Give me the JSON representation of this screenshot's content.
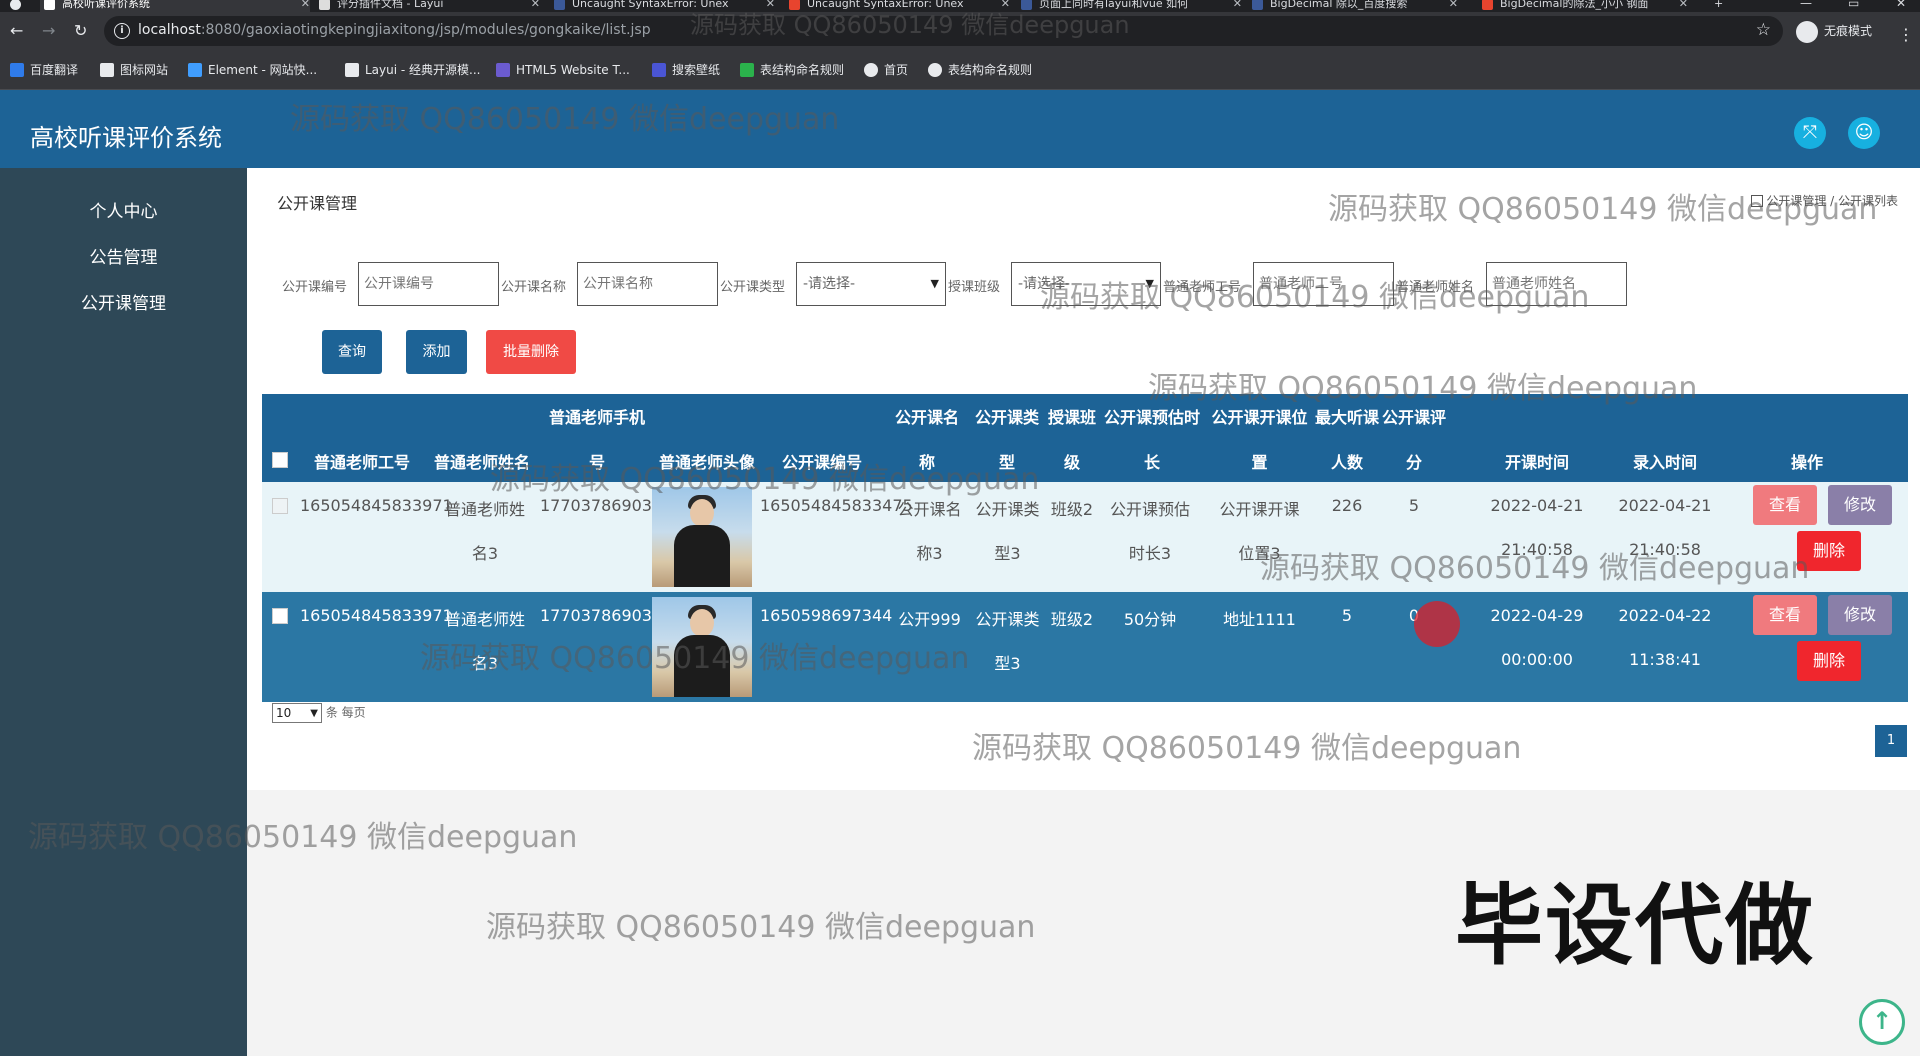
{
  "browser": {
    "tabs": [
      {
        "title": "高校听课评价系统",
        "active": true,
        "color": "#ffffff"
      },
      {
        "title": "评分插件文档 - Layui",
        "active": false,
        "color": "#dddddd"
      },
      {
        "title": "Uncaught SyntaxError: Unex",
        "active": false,
        "color": "#3b5998"
      },
      {
        "title": "Uncaught SyntaxError: Unex",
        "active": false,
        "color": "#e8442e"
      },
      {
        "title": "页面上同时有layui和vue 如何",
        "active": false,
        "color": "#3b5998"
      },
      {
        "title": "BigDecimal 除以_百度搜索",
        "active": false,
        "color": "#3b5998"
      },
      {
        "title": "BigDecimal的除法_小小 钢面",
        "active": false,
        "color": "#e8442e"
      }
    ],
    "new_tab": "+",
    "url_host": "localhost",
    "url_rest": ":8080/gaoxiaotingkepingjiaxitong/jsp/modules/gongkaike/list.jsp",
    "incognito_label": "无痕模式",
    "bookmarks": [
      {
        "label": "百度翻译",
        "icon": "translate-icon",
        "color": "#2f7bea"
      },
      {
        "label": "图标网站",
        "icon": "flag-icon",
        "color": "#e8eaed"
      },
      {
        "label": "Element - 网站快...",
        "icon": "element-icon",
        "color": "#409eff"
      },
      {
        "label": "Layui - 经典开源模...",
        "icon": "layui-icon",
        "color": "#e8eaed"
      },
      {
        "label": "HTML5 Website T...",
        "icon": "html5-icon",
        "color": "#6b5bcf"
      },
      {
        "label": "搜索壁纸",
        "icon": "wallpaper-icon",
        "color": "#4a55d4"
      },
      {
        "label": "表结构命名规则",
        "icon": "table-icon",
        "color": "#2bb24c"
      },
      {
        "label": "首页",
        "icon": "globe-icon",
        "color": "#e8eaed"
      },
      {
        "label": "表结构命名规则",
        "icon": "globe-icon",
        "color": "#e8eaed"
      }
    ]
  },
  "app": {
    "title": "高校听课评价系统",
    "accent": "#1d6396",
    "sidebar_bg": "#2e4857"
  },
  "sidebar": {
    "items": [
      {
        "label": "个人中心"
      },
      {
        "label": "公告管理"
      },
      {
        "label": "公开课管理"
      }
    ]
  },
  "page": {
    "title": "公开课管理",
    "breadcrumb": "公开课管理 / 公开课列表"
  },
  "search": {
    "fields": [
      {
        "label": "公开课编号",
        "placeholder": "公开课编号"
      },
      {
        "label": "公开课名称",
        "placeholder": "公开课名称"
      },
      {
        "label": "公开课类型",
        "select": "-请选择-"
      },
      {
        "label": "授课班级",
        "select": "-请选择-"
      },
      {
        "label": "普通老师工号",
        "placeholder": "普通老师工号"
      },
      {
        "label": "普通老师姓名",
        "placeholder": "普通老师姓名"
      }
    ],
    "query_label": "查询",
    "add_label": "添加",
    "batch_delete_label": "批量删除"
  },
  "table": {
    "headers": {
      "teacher_no": "普通老师工号",
      "teacher_name": "普通老师姓名",
      "phone_top": "普通老师手机",
      "phone_bottom": "号",
      "avatar": "普通老师头像",
      "course_no": "公开课编号",
      "course_name_top": "公开课名",
      "course_name_bottom": "称",
      "course_type_top": "公开课类",
      "course_type_bottom": "型",
      "class_top": "授课班",
      "class_bottom": "级",
      "duration_top": "公开课预估时",
      "duration_bottom": "长",
      "location_top": "公开课开课位",
      "location_bottom": "置",
      "max_top": "最大听课",
      "max_bottom": "人数",
      "score_top": "公开课评",
      "score_bottom": "分",
      "start_time": "开课时间",
      "entry_time": "录入时间",
      "actions": "操作"
    },
    "rows": [
      {
        "teacher_no": "165054845833971",
        "teacher_name_1": "普通老师姓",
        "teacher_name_2": "名3",
        "phone": "17703786903",
        "course_no": "165054845833475",
        "course_name_1": "公开课名",
        "course_name_2": "称3",
        "course_type_1": "公开课类",
        "course_type_2": "型3",
        "class": "班级2",
        "duration_1": "公开课预估",
        "duration_2": "时长3",
        "location_1": "公开课开课",
        "location_2": "位置3",
        "max": "226",
        "score": "5",
        "start_1": "2022-04-21",
        "start_2": "21:40:58",
        "entry_1": "2022-04-21",
        "entry_2": "21:40:58",
        "view": "查看",
        "edit": "修改",
        "delete": "删除"
      },
      {
        "teacher_no": "165054845833971",
        "teacher_name_1": "普通老师姓",
        "teacher_name_2": "名3",
        "phone": "17703786903",
        "course_no": "1650598697344",
        "course_name_1": "公开999",
        "course_name_2": "",
        "course_type_1": "公开课类",
        "course_type_2": "型3",
        "class": "班级2",
        "duration_1": "50分钟",
        "duration_2": "",
        "location_1": "地址1111",
        "location_2": "",
        "max": "5",
        "score": "0",
        "start_1": "2022-04-29",
        "start_2": "00:00:00",
        "entry_1": "2022-04-22",
        "entry_2": "11:38:41",
        "view": "查看",
        "edit": "修改",
        "delete": "删除"
      }
    ]
  },
  "pagination": {
    "page_size": "10",
    "per_page_label": "条 每页",
    "current_page": "1"
  },
  "watermark": "源码获取 QQ86050149 微信deepguan",
  "stamp": "毕设代做"
}
